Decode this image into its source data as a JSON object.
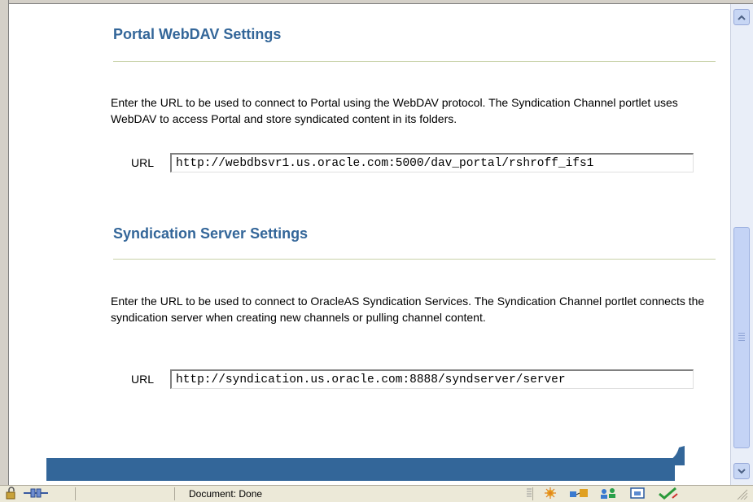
{
  "webdav": {
    "title": "Portal WebDAV Settings",
    "description": "Enter the URL to be used to connect to Portal using the WebDAV protocol. The Syndication Channel portlet uses WebDAV to access Portal and store syndicated content in its folders.",
    "url_label": "URL",
    "url_value": "http://webdbsvr1.us.oracle.com:5000/dav_portal/rshroff_ifs1"
  },
  "syndication": {
    "title": "Syndication Server Settings",
    "description": "Enter the URL to be used to connect to OracleAS Syndication Services. The Syndication Channel portlet connects the syndication server when creating new channels or pulling channel content.",
    "url_label": "URL",
    "url_value": "http://syndication.us.oracle.com:8888/syndserver/server"
  },
  "statusbar": {
    "text": "Document: Done",
    "icons": [
      "lock-icon",
      "connection-icon",
      "sparkle-icon",
      "network-icon",
      "people-icon",
      "photo-icon",
      "checkmark-icon"
    ]
  },
  "colors": {
    "heading": "#336699",
    "footer_band": "#336699",
    "divider": "#c8d2a8"
  }
}
